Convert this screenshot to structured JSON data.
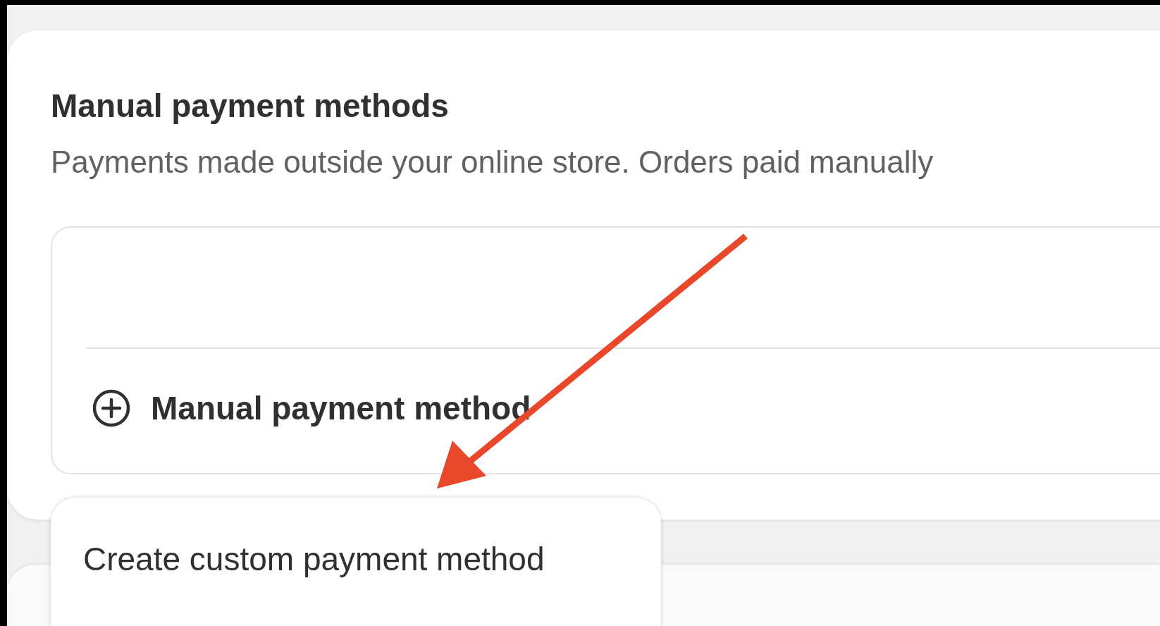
{
  "section": {
    "title": "Manual payment methods",
    "description": "Payments made outside your online store. Orders paid manually"
  },
  "add_button": {
    "label": "Manual payment method"
  },
  "menu": {
    "items": [
      {
        "label": "Create custom payment method"
      }
    ]
  }
}
